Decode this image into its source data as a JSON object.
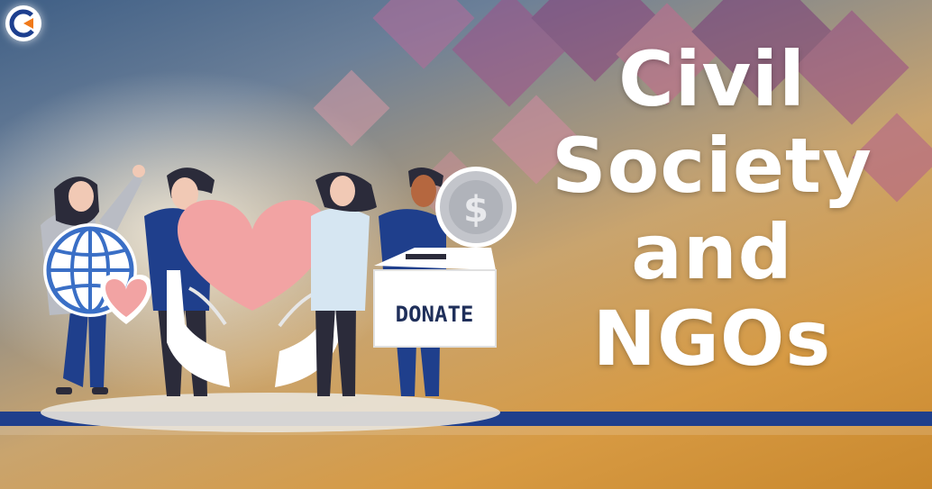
{
  "title_lines": [
    "Civil",
    "Society",
    "and",
    "NGOs"
  ],
  "donate_box_label": "DONATE",
  "coin_symbol": "$",
  "colors": {
    "navy": "#1f3f8c",
    "heart_pink": "#f2a3a3",
    "logo_orange": "#f07a1a",
    "logo_blue": "#1d3f8f"
  },
  "icons": [
    "company-logo-icon",
    "globe-icon",
    "heart-icon",
    "dollar-coin-icon",
    "donation-box-icon",
    "open-hands-icon"
  ]
}
